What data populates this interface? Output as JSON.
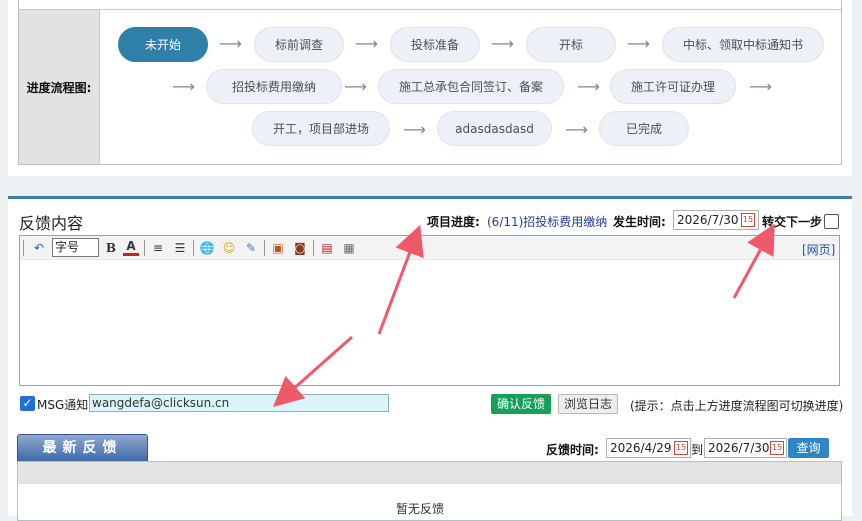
{
  "progress_flow": {
    "label": "进度流程图:",
    "steps": [
      {
        "label": "未开始",
        "active": true
      },
      {
        "label": "标前调查"
      },
      {
        "label": "投标准备"
      },
      {
        "label": "开标"
      },
      {
        "label": "中标、领取中标通知书"
      },
      {
        "label": "招投标费用缴纳"
      },
      {
        "label": "施工总承包合同签订、备案"
      },
      {
        "label": "施工许可证办理"
      },
      {
        "label": "开工，项目部进场"
      },
      {
        "label": "adasdasdasd"
      },
      {
        "label": "已完成"
      }
    ],
    "arrow_glyph": "⟶"
  },
  "feedback": {
    "title": "反馈内容",
    "progress_label": "项目进度:",
    "progress_value": "(6/11)招投标费用缴纳",
    "time_label": "发生时间:",
    "occur_date": "2026/7/30",
    "transfer_label": "转交下一步",
    "transfer_checked": false,
    "editor": {
      "font_size_value": "字号",
      "webpage_link": "[网页]",
      "icons": [
        "undo-icon",
        "bold-icon",
        "font-color-icon",
        "align-icon",
        "list-icon",
        "link-icon",
        "emoticon-icon",
        "edit-icon",
        "image-icon",
        "flash-icon",
        "media-icon",
        "table-icon"
      ]
    },
    "msg_label": "MSG通知",
    "msg_checked": true,
    "email": "wangdefa@clicksun.cn",
    "confirm_label": "确认反馈",
    "log_label": "浏览日志",
    "hint": "(提示：点击上方进度流程图可切换进度)"
  },
  "latest": {
    "tab_label": "最新反馈",
    "time_label": "反馈时间:",
    "date_from": "2026/4/29",
    "to_label": "到",
    "date_to": "2026/7/30",
    "query_label": "查询",
    "empty_text": "暂无反馈"
  },
  "colors": {
    "active_step": "#2e80a8",
    "confirm_button": "#16a05a",
    "query_button": "#2f86c6",
    "annotation_arrow": "#ef5a6a"
  }
}
